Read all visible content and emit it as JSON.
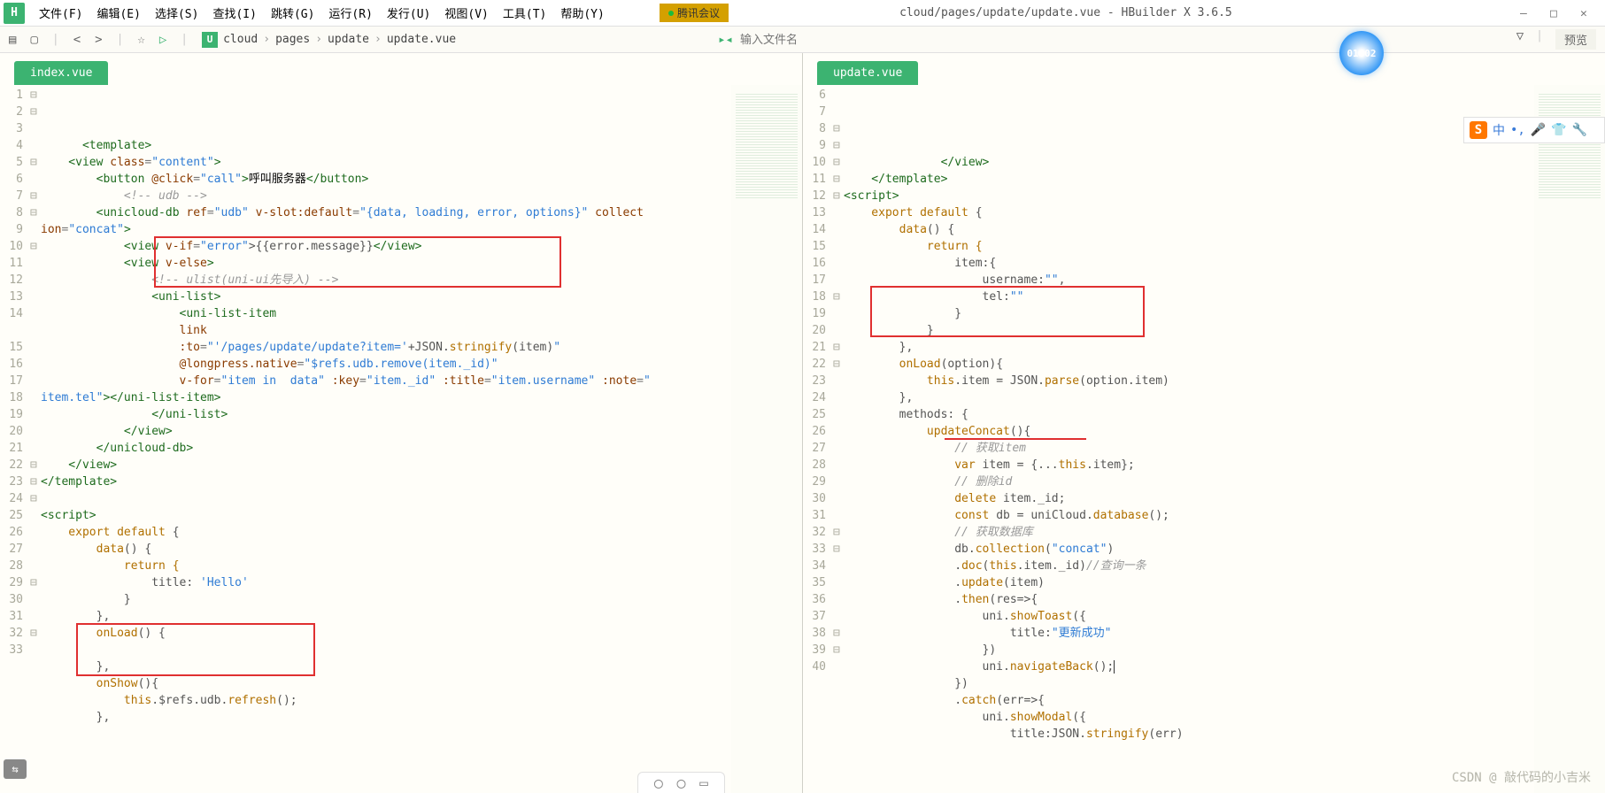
{
  "window": {
    "title": "cloud/pages/update/update.vue - HBuilder X 3.6.5",
    "tab_badge": "腾讯会议"
  },
  "menu": [
    "文件(F)",
    "编辑(E)",
    "选择(S)",
    "查找(I)",
    "跳转(G)",
    "运行(R)",
    "发行(U)",
    "视图(V)",
    "工具(T)",
    "帮助(Y)"
  ],
  "toolbar": {
    "breadcrumb": [
      "cloud",
      "pages",
      "update",
      "update.vue"
    ],
    "placeholder": "输入文件名",
    "preview": "预览",
    "clock": "01:02"
  },
  "left": {
    "tab": "index.vue",
    "lines": [
      "1",
      "2",
      "3",
      "4",
      "5",
      "6",
      "7",
      "8",
      "9",
      "10",
      "11",
      "12",
      "13",
      "14",
      "",
      "15",
      "16",
      "17",
      "18",
      "19",
      "20",
      "21",
      "22",
      "23",
      "24",
      "25",
      "26",
      "27",
      "28",
      "29",
      "30",
      "31",
      "32",
      "33"
    ],
    "fold": [
      "⊟",
      "⊟",
      "",
      "",
      "⊟",
      "",
      "⊟",
      "⊟",
      "",
      "⊟",
      "",
      "",
      "",
      "",
      "",
      "",
      "",
      "",
      "",
      "",
      "",
      "",
      "⊟",
      "⊟",
      "⊟",
      "",
      "",
      "",
      "",
      "⊟",
      "",
      "",
      "⊟",
      "",
      ""
    ],
    "code": {
      "l1": {
        "a": "<template>"
      },
      "l2": {
        "a": "    <view ",
        "b": "class",
        "c": "=",
        "d": "\"content\"",
        "e": ">"
      },
      "l3": {
        "a": "        <button ",
        "b": "@click",
        "c": "=",
        "d": "\"call\"",
        "e": ">",
        "f": "呼叫服务器",
        "g": "</button>"
      },
      "l4": {
        "a": "            <!-- udb -->"
      },
      "l5": {
        "a": "        <unicloud-db ",
        "b": "ref",
        "c": "=",
        "d": "\"udb\"",
        "e": " v-slot:default",
        "f": "=",
        "g": "\"{data, loading, error, options}\"",
        "h": " collect"
      },
      "l5b": {
        "a": "ion",
        "b": "=",
        "c": "\"concat\"",
        "d": ">"
      },
      "l6": {
        "a": "            <view ",
        "b": "v-if",
        "c": "=",
        "d": "\"error\"",
        "e": ">{{error.message}}",
        "f": "</view>"
      },
      "l7": {
        "a": "            <view ",
        "b": "v-else",
        "c": ">"
      },
      "l8": {
        "a": "                <!-- ulist(uni-ui先导入) -->"
      },
      "l9": {
        "a": "                <uni-list>"
      },
      "l10": {
        "a": "                    <uni-list-item"
      },
      "l11": {
        "a": "                    link"
      },
      "l12": {
        "a": "                    :to",
        "b": "=",
        "c": "\"'/pages/update/update?item='",
        "d": "+JSON.",
        "e": "stringify",
        "f": "(item)",
        "g": "\""
      },
      "l13": {
        "a": "                    @longpress.native",
        "b": "=",
        "c": "\"$refs.udb.remove(item._id)\""
      },
      "l14": {
        "a": "                    v-for",
        "b": "=",
        "c": "\"item in  data\"",
        "d": " :key",
        "e": "=",
        "f": "\"item._id\"",
        "g": " :title",
        "h": "=",
        "i": "\"item.username\"",
        "j": " :note",
        "k": "=",
        "l": "\""
      },
      "l14b": {
        "a": "item.tel\"",
        "b": "></uni-list-item>"
      },
      "l15": {
        "a": "                </uni-list>"
      },
      "l16": {
        "a": "            </view>"
      },
      "l17": {
        "a": "        </unicloud-db>"
      },
      "l18": {
        "a": "    </view>"
      },
      "l19": {
        "a": "</template>"
      },
      "l20": {
        "a": ""
      },
      "l21": {
        "a": "<script>"
      },
      "l22": {
        "a": "    export default {"
      },
      "l23": {
        "a": "        data",
        "b": "() {"
      },
      "l24": {
        "a": "            return {"
      },
      "l25": {
        "a": "                title: ",
        "b": "'Hello'"
      },
      "l26": {
        "a": "            }"
      },
      "l27": {
        "a": "        },"
      },
      "l28": {
        "a": "        onLoad",
        "b": "() {"
      },
      "l29": {
        "a": ""
      },
      "l30": {
        "a": "        },"
      },
      "l31": {
        "a": "        onShow",
        "b": "(){"
      },
      "l32": {
        "a": "            this",
        ".": ".",
        "b": "$refs.udb.",
        "c": "refresh",
        "d": "();"
      },
      "l33": {
        "a": "        },"
      }
    }
  },
  "right": {
    "tab": "update.vue",
    "lines": [
      "6",
      "7",
      "8",
      "9",
      "10",
      "11",
      "12",
      "13",
      "14",
      "15",
      "16",
      "17",
      "18",
      "19",
      "20",
      "21",
      "22",
      "23",
      "24",
      "25",
      "26",
      "27",
      "28",
      "29",
      "30",
      "31",
      "32",
      "33",
      "34",
      "35",
      "36",
      "37",
      "38",
      "39",
      "40"
    ],
    "fold": [
      "",
      "",
      "⊟",
      "⊟",
      "⊟",
      "⊟",
      "⊟",
      "",
      "",
      "",
      "",
      "",
      "⊟",
      "",
      "",
      "⊟",
      "⊟",
      "",
      "",
      "",
      "",
      "",
      "",
      "",
      "",
      "",
      "⊟",
      "⊟",
      "",
      "",
      "",
      "",
      "⊟",
      "⊟",
      ""
    ],
    "code": {
      "l6": {
        "a": "        </view>"
      },
      "l7": {
        "a": "    </template>"
      },
      "l8": {
        "a": "<script>"
      },
      "l9": {
        "a": "    export default {"
      },
      "l10": {
        "a": "        data",
        "b": "() {"
      },
      "l11": {
        "a": "            return {"
      },
      "l12": {
        "a": "                item:{"
      },
      "l13": {
        "a": "                    username:",
        "b": "\"\"",
        "c": ","
      },
      "l14": {
        "a": "                    tel:",
        "b": "\"\""
      },
      "l15": {
        "a": "                }"
      },
      "l16": {
        "a": "            }"
      },
      "l17": {
        "a": "        },"
      },
      "l18": {
        "a": "        onLoad",
        "b": "(option){"
      },
      "l19": {
        "a": "            this",
        ".": ".",
        "b": "item = JSON.",
        "c": "parse",
        "d": "(option.item)"
      },
      "l20": {
        "a": "        },"
      },
      "l21": {
        "a": "        methods: {"
      },
      "l22": {
        "a": "            updateConcat",
        "b": "(){"
      },
      "l23": {
        "a": "                // 获取item"
      },
      "l24": {
        "a": "                var",
        "b": " item = {...",
        "c": "this",
        "d": ".item};"
      },
      "l25": {
        "a": "                // 删除id"
      },
      "l26": {
        "a": "                delete",
        "b": " item._id;"
      },
      "l27": {
        "a": "                const",
        "b": " db = uniCloud.",
        "c": "database",
        "d": "();"
      },
      "l28": {
        "a": "                // 获取数据库"
      },
      "l29": {
        "a": "                db.",
        "b": "collection",
        "c": "(",
        "d": "\"concat\"",
        "e": ")"
      },
      "l30": {
        "a": "                .",
        "b": "doc",
        "c": "(",
        "d": "this",
        "e": ".item._id)",
        "f": "//查询一条"
      },
      "l31": {
        "a": "                .",
        "b": "update",
        "c": "(item)"
      },
      "l32": {
        "a": "                .",
        "b": "then",
        "c": "(res=>{"
      },
      "l33": {
        "a": "                    uni.",
        "b": "showToast",
        "c": "({"
      },
      "l34": {
        "a": "                        title:",
        "b": "\"更新成功\""
      },
      "l35": {
        "a": "                    })"
      },
      "l36": {
        "a": "                    uni.",
        "b": "navigateBack",
        "c": "();"
      },
      "l37": {
        "a": "                })"
      },
      "l38": {
        "a": "                .",
        "b": "catch",
        "c": "(err=>{"
      },
      "l39": {
        "a": "                    uni.",
        "b": "showModal",
        "c": "({"
      },
      "l40": {
        "a": "                        title:JSON.",
        "b": "stringify",
        "c": "(err)"
      }
    }
  },
  "author": "CSDN @ 敲代码的小吉米",
  "sg": {
    "zh": "中"
  }
}
